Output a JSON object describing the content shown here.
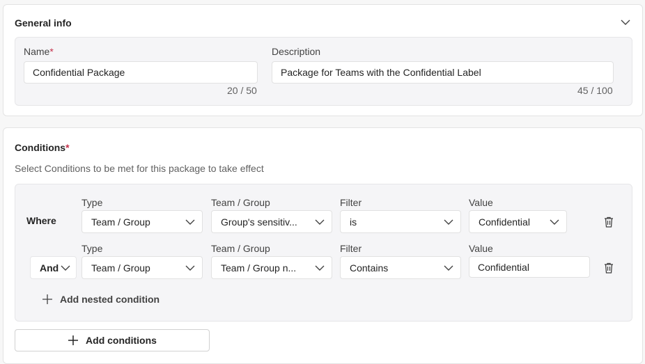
{
  "general": {
    "title": "General info",
    "name_label": "Name",
    "required_mark": "*",
    "name_value": "Confidential Package",
    "name_counter": "20 / 50",
    "desc_label": "Description",
    "desc_value": "Package for Teams with the Confidential Label",
    "desc_counter": "45 / 100",
    "collapse_icon": "chevron-down-icon"
  },
  "conditions": {
    "title": "Conditions",
    "required_mark": "*",
    "subtitle": "Select Conditions to be met for this package to take effect",
    "rows": [
      {
        "connector": "Where",
        "type_label": "Type",
        "type_value": "Team / Group",
        "field_label": "Team / Group",
        "field_value": "Group's sensitiv...",
        "filter_label": "Filter",
        "filter_value": "is",
        "value_label": "Value",
        "value_value": "Confidential",
        "delete_icon": "trash-icon"
      },
      {
        "connector": "And",
        "type_label": "Type",
        "type_value": "Team / Group",
        "field_label": "Team / Group",
        "field_value": "Team / Group n...",
        "filter_label": "Filter",
        "filter_value": "Contains",
        "value_label": "Value",
        "value_value": "Confidential",
        "delete_icon": "trash-icon"
      }
    ],
    "add_nested_label": "Add nested condition",
    "add_conditions_label": "Add conditions",
    "add_icon": "plus-icon"
  },
  "colors": {
    "required": "#c4314b",
    "inner_panel": "#f5f5f7",
    "text": "#242424"
  }
}
